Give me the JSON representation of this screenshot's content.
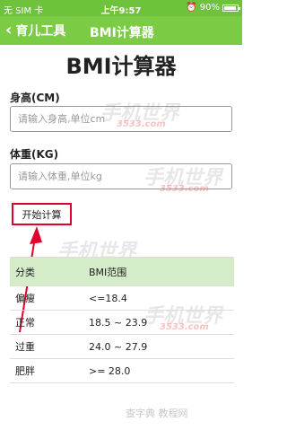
{
  "status_bar": {
    "carrier": "无 SIM 卡",
    "time": "上午9:57",
    "battery": "90%",
    "battery_level": 0.9
  },
  "nav": {
    "back_label": "育儿工具",
    "title": "BMI计算器"
  },
  "page_title": "BMI计算器",
  "height_field": {
    "label": "身高(CM)",
    "placeholder": "请输入身高,单位cm",
    "value": ""
  },
  "weight_field": {
    "label": "体重(KG)",
    "placeholder": "请输入体重,单位kg",
    "value": ""
  },
  "calc_button": "开始计算",
  "table": {
    "headers": [
      "分类",
      "BMI范围"
    ],
    "rows": [
      [
        "偏瘦",
        "<=18.4"
      ],
      [
        "正常",
        "18.5 ~ 23.9"
      ],
      [
        "过重",
        "24.0 ~ 27.9"
      ],
      [
        "肥胖",
        ">= 28.0"
      ]
    ]
  },
  "watermarks": {
    "brand": "手机世界",
    "site": "3533.com",
    "footer": "查字典 教程网"
  },
  "colors": {
    "nav_green": "#7bcb44",
    "status_green": "#6fc23c",
    "highlight_red": "#e0002a",
    "table_header_bg": "#d4ecc8"
  }
}
